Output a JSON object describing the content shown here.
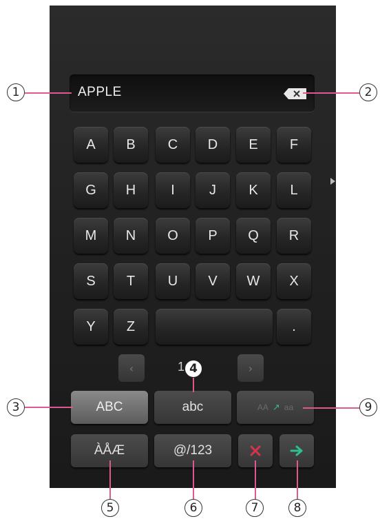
{
  "input": {
    "text": "APPLE"
  },
  "keys": [
    [
      "A",
      "B",
      "C",
      "D",
      "E",
      "F"
    ],
    [
      "G",
      "H",
      "I",
      "J",
      "K",
      "L"
    ],
    [
      "M",
      "N",
      "O",
      "P",
      "Q",
      "R"
    ],
    [
      "S",
      "T",
      "U",
      "V",
      "W",
      "X"
    ]
  ],
  "last_row": {
    "k1": "Y",
    "k2": "Z",
    "period": "."
  },
  "pager": {
    "label": "1"
  },
  "modes": {
    "upper": "ABC",
    "lower": "abc",
    "accented": "ÀÅÆ",
    "symbols": "@/123",
    "case_toggle_left": "AA",
    "case_toggle_right": "aa"
  },
  "callouts": [
    "1",
    "2",
    "3",
    "4",
    "5",
    "6",
    "7",
    "8",
    "9"
  ],
  "colors": {
    "accent_line": "#e0588f",
    "delete": "#d9334c",
    "enter": "#2fbf8f"
  }
}
